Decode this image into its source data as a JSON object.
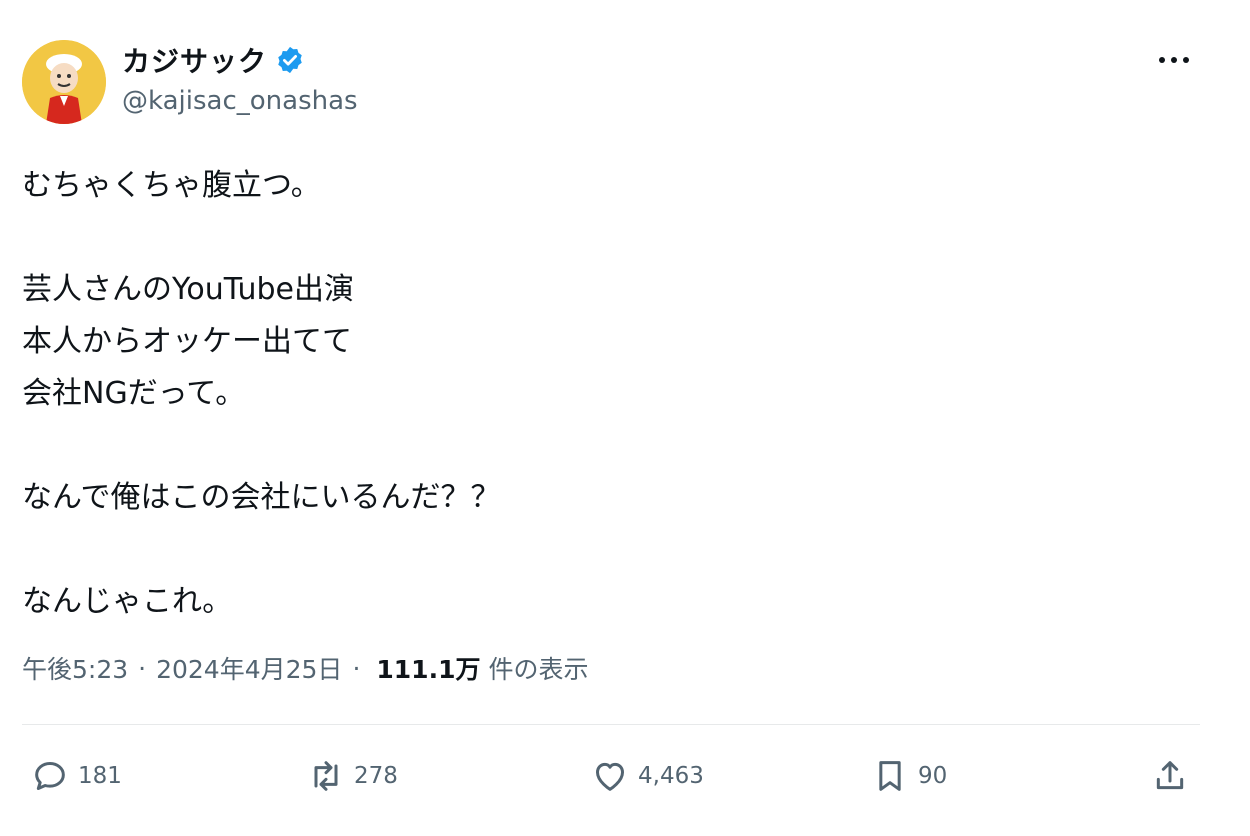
{
  "author": {
    "display_name": "カジサック",
    "handle": "@kajisac_onashas",
    "verified_badge_color": "#1d9bf0"
  },
  "tweet": {
    "lines": [
      "むちゃくちゃ腹立つ。",
      "",
      "芸人さんのYouTube出演",
      "本人からオッケー出てて",
      "会社NGだって。",
      "",
      "なんで俺はこの会社にいるんだ？？",
      "",
      "なんじゃこれ。"
    ]
  },
  "meta": {
    "time": "午後5:23",
    "separator": "·",
    "date": "2024年4月25日",
    "views_count": "111.1万",
    "views_label": "件の表示"
  },
  "actions": {
    "reply": {
      "icon": "reply-icon",
      "count": "181"
    },
    "repost": {
      "icon": "repost-icon",
      "count": "278"
    },
    "like": {
      "icon": "heart-icon",
      "count": "4,463"
    },
    "bookmark": {
      "icon": "bookmark-icon",
      "count": "90"
    },
    "share": {
      "icon": "share-icon"
    }
  },
  "colors": {
    "text_primary": "#0f1419",
    "text_secondary": "#536471",
    "divider": "#e7e9ea",
    "accent": "#1d9bf0"
  }
}
